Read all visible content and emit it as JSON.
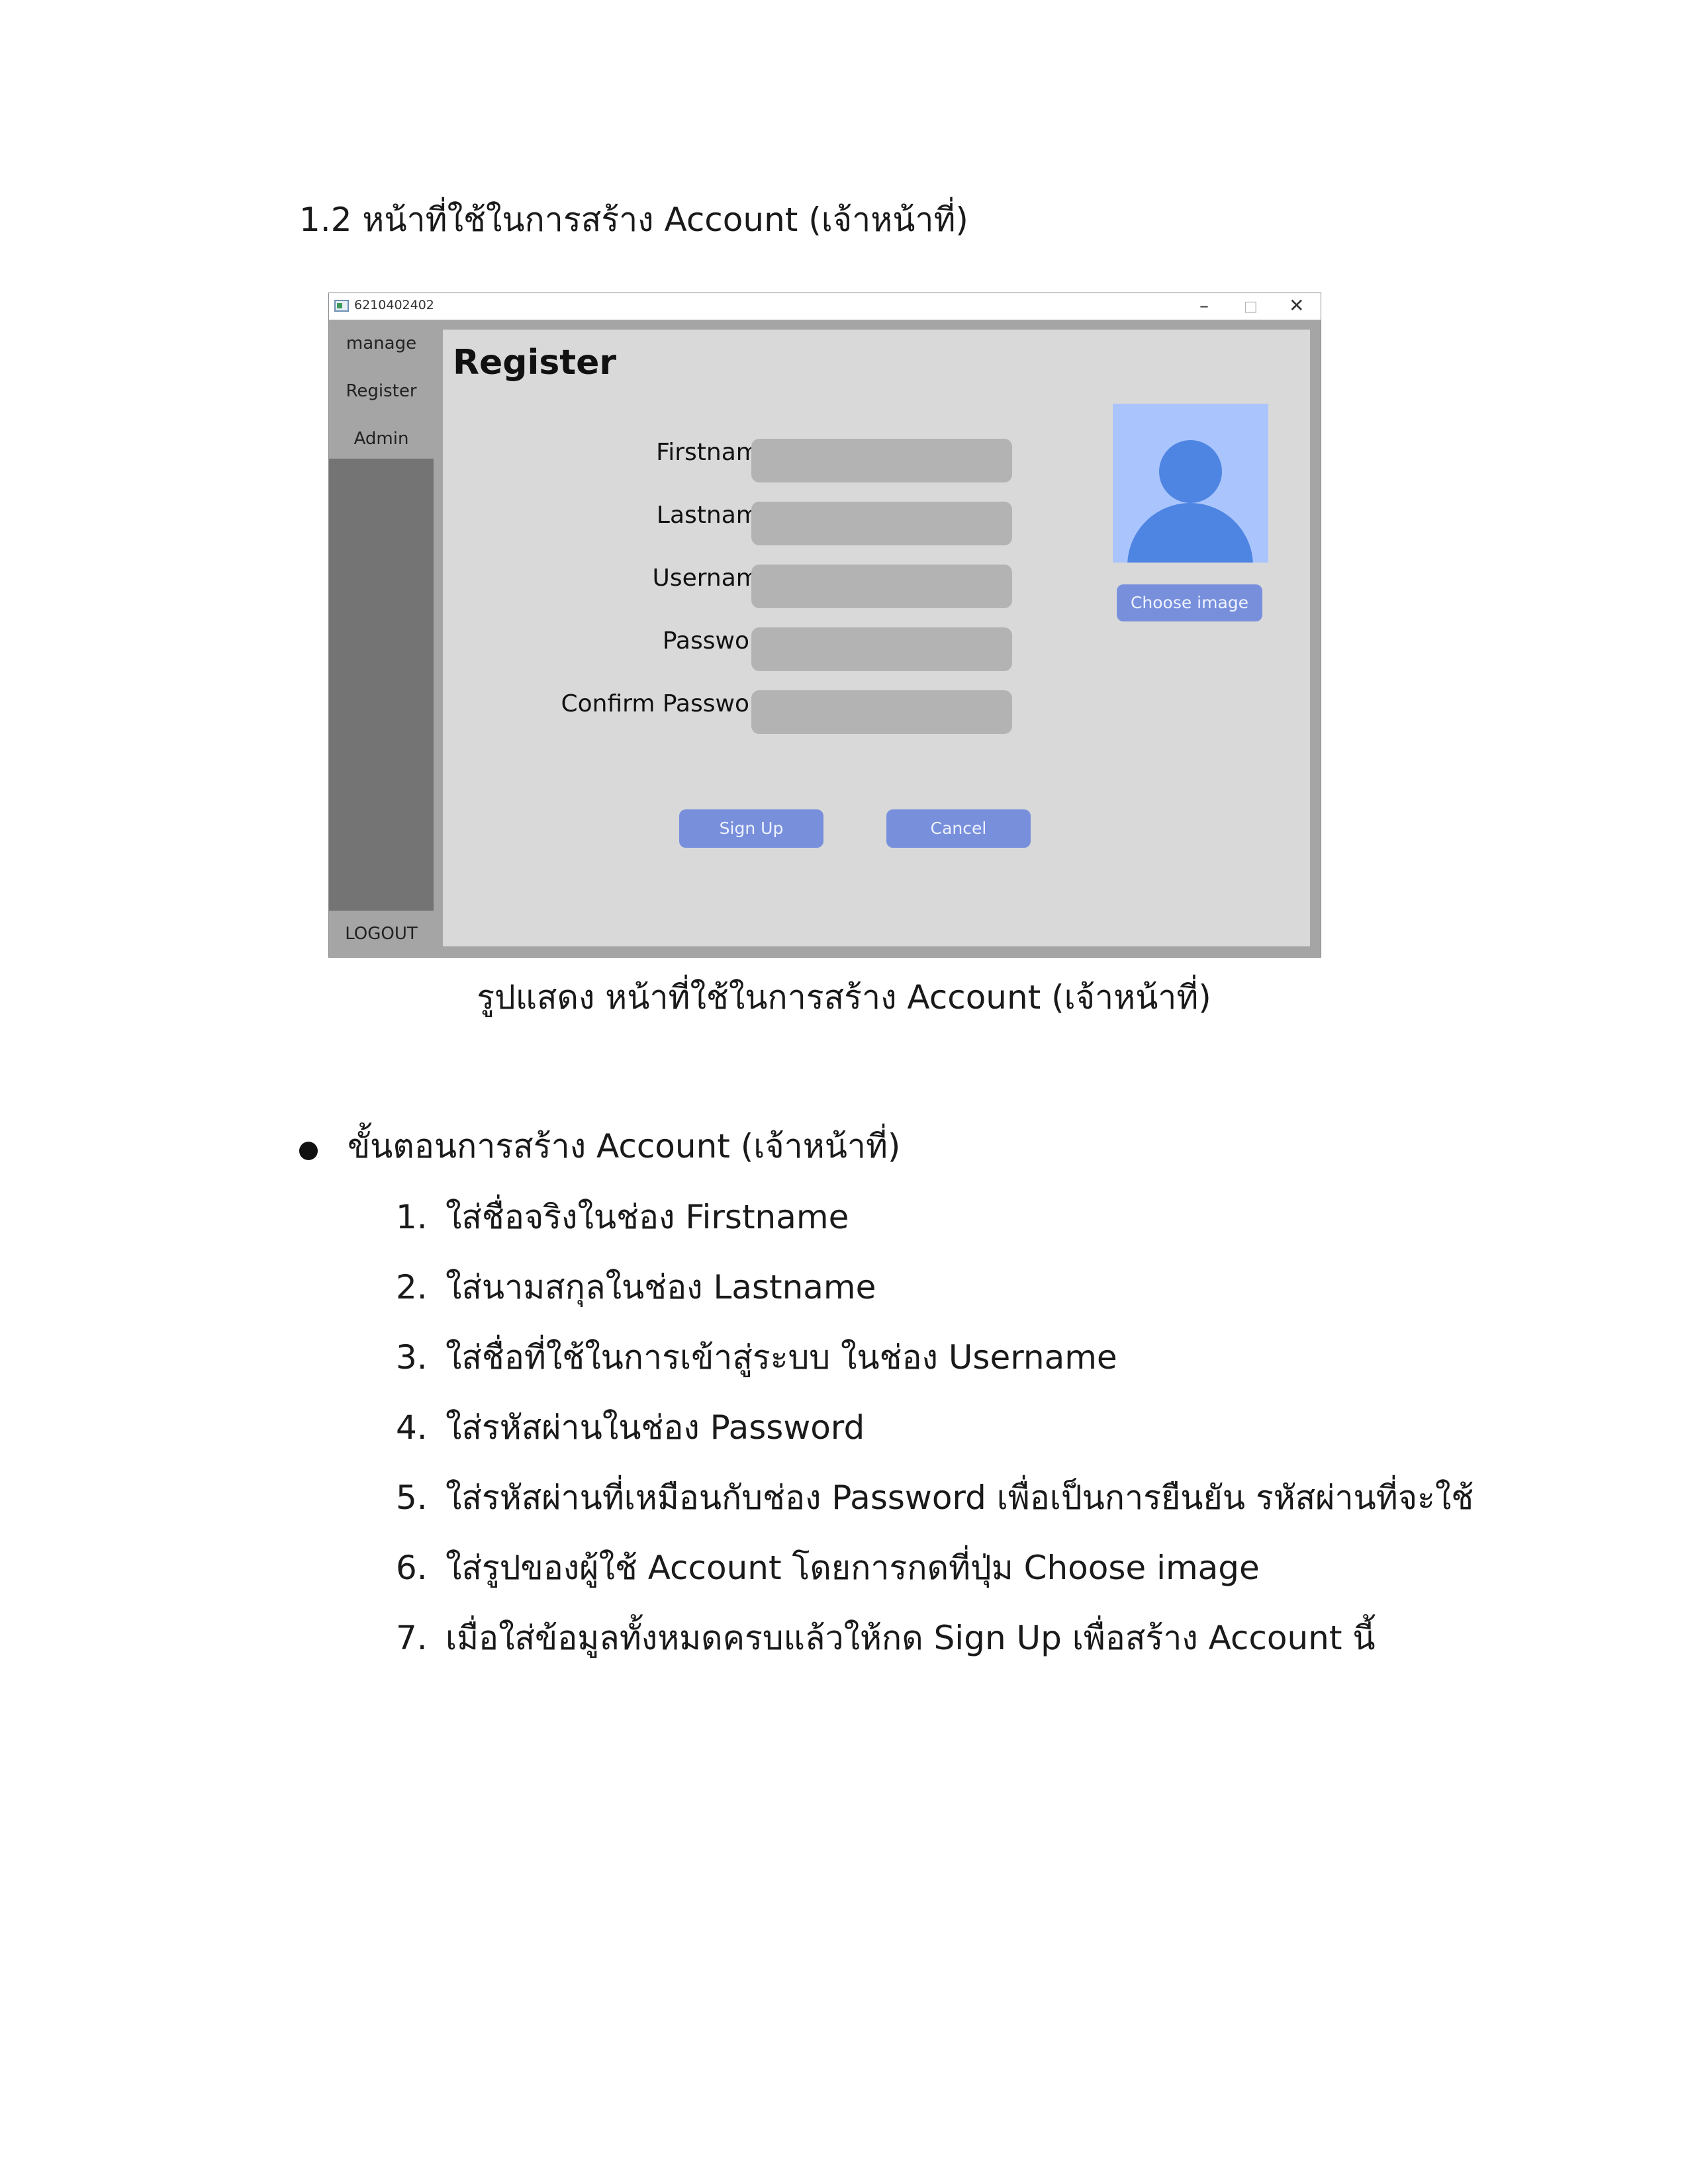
{
  "heading": "1.2 หน้าที่ใช้ในการสร้าง Account (เจ้าหน้าที่)",
  "window": {
    "title": "6210402402",
    "controls": {
      "minimize": "–",
      "maximize": "□",
      "close": "✕"
    },
    "sidebar": {
      "items": [
        "manage",
        "Register",
        "Admin"
      ],
      "logout": "LOGOUT"
    },
    "form": {
      "title": "Register",
      "fields": [
        {
          "label": "Firstname",
          "value": ""
        },
        {
          "label": "Lastname",
          "value": ""
        },
        {
          "label": "Username",
          "value": ""
        },
        {
          "label": "Password",
          "value": ""
        },
        {
          "label": "Confirm Password",
          "value": ""
        }
      ],
      "choose_image": "Choose image",
      "sign_up": "Sign Up",
      "cancel": "Cancel"
    }
  },
  "caption": "รูปแสดง หน้าที่ใช้ในการสร้าง Account (เจ้าหน้าที่)",
  "steps_title": "ขั้นตอนการสร้าง Account (เจ้าหน้าที่)",
  "steps": [
    {
      "num": "1.",
      "text": "ใส่ชื่อจริงในช่อง Firstname"
    },
    {
      "num": "2.",
      "text": "ใส่นามสกุลในช่อง Lastname"
    },
    {
      "num": "3.",
      "text": "ใส่ชื่อที่ใช้ในการเข้าสู่ระบบ ในช่อง Username"
    },
    {
      "num": "4.",
      "text": "ใส่รหัสผ่านในช่อง Password"
    },
    {
      "num": "5.",
      "text": "ใส่รหัสผ่านที่เหมือนกับช่อง Password เพื่อเป็นการยืนยัน รหัสผ่านที่จะใช้"
    },
    {
      "num": "6.",
      "text": "ใส่รูปของผู้ใช้ Account โดยการกดที่ปุ่ม Choose image"
    },
    {
      "num": "7.",
      "text": "เมื่อใส่ข้อมูลทั้งหมดครบแล้วให้กด Sign Up เพื่อสร้าง Account นี้"
    }
  ]
}
